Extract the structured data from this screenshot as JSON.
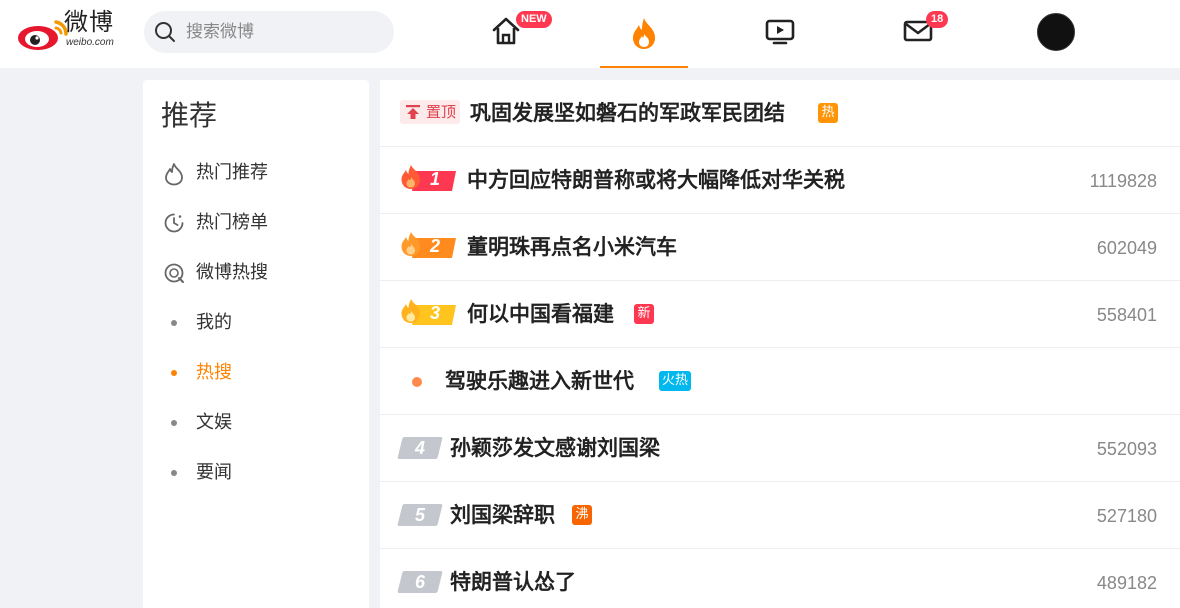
{
  "header": {
    "logo_text": "微博",
    "logo_sub": "weibo.com",
    "search_placeholder": "搜索微博",
    "home_badge": "NEW",
    "message_badge": "18"
  },
  "sidebar": {
    "title": "推荐",
    "items": [
      {
        "label": "热门推荐",
        "icon": "flame-outline-icon"
      },
      {
        "label": "热门榜单",
        "icon": "clock-outline-icon"
      },
      {
        "label": "微博热搜",
        "icon": "search-circle-icon"
      }
    ],
    "subitems": [
      {
        "label": "我的"
      },
      {
        "label": "热搜"
      },
      {
        "label": "文娱"
      },
      {
        "label": "要闻"
      }
    ]
  },
  "hot_list": {
    "pinned": {
      "badge": "置顶",
      "title": "巩固发展坚如磐石的军政军民团结",
      "tag": "热"
    },
    "rows": [
      {
        "rank": "1",
        "title": "中方回应特朗普称或将大幅降低对华关税",
        "tag": "",
        "count": "1119828"
      },
      {
        "rank": "2",
        "title": "董明珠再点名小米汽车",
        "tag": "",
        "count": "602049"
      },
      {
        "rank": "3",
        "title": "何以中国看福建",
        "tag": "新",
        "count": "558401"
      },
      {
        "rank": "",
        "title": "驾驶乐趣进入新世代",
        "tag": "火热",
        "count": ""
      },
      {
        "rank": "4",
        "title": "孙颖莎发文感谢刘国梁",
        "tag": "",
        "count": "552093"
      },
      {
        "rank": "5",
        "title": "刘国梁辞职",
        "tag": "沸",
        "count": "527180"
      },
      {
        "rank": "6",
        "title": "特朗普认怂了",
        "tag": "",
        "count": "489182"
      }
    ]
  },
  "colors": {
    "accent": "#ff8200",
    "badge_red": "#ff3852",
    "tag_hot": "#ff9406",
    "tag_fire": "#00b7ee",
    "tag_boil": "#f86400",
    "rank_1": "#ff3852",
    "rank_2": "#ff8a1d",
    "rank_3": "#ffc41e"
  }
}
